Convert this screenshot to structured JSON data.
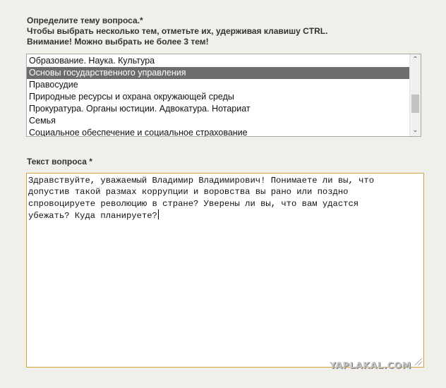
{
  "topic_label": {
    "line1": "Определите тему вопроса.*",
    "line2": "Чтобы выбрать несколько тем, отметьте их, удерживая клавишу CTRL.",
    "line3": "Внимание! Можно выбрать не более 3 тем!"
  },
  "topics": {
    "options": [
      {
        "label": "Образование. Наука. Культура",
        "selected": false
      },
      {
        "label": "Основы государственного управления",
        "selected": true
      },
      {
        "label": "Правосудие",
        "selected": false
      },
      {
        "label": "Природные ресурсы и охрана окружающей среды",
        "selected": false
      },
      {
        "label": "Прокуратура. Органы юстиции. Адвокатура. Нотариат",
        "selected": false
      },
      {
        "label": "Семья",
        "selected": false
      },
      {
        "label": "Социальное обеспечение и социальное страхование",
        "selected": false
      }
    ]
  },
  "question": {
    "label": "Текст вопроса *",
    "text": "Здравствуйте, уважаемый Владимир Владимирович! Понимаете ли вы, что\nдопустив такой размах коррупции и воровства вы рано или поздно\nспровоцируете революцию в стране? Уверены ли вы, что вам удастся\nубежать? Куда планируете?"
  },
  "watermark": "YAPLAKAL.COM",
  "colors": {
    "background": "#f1efea",
    "selected_option": "#6d6d6d",
    "textarea_focus_border": "#d3a43b"
  }
}
